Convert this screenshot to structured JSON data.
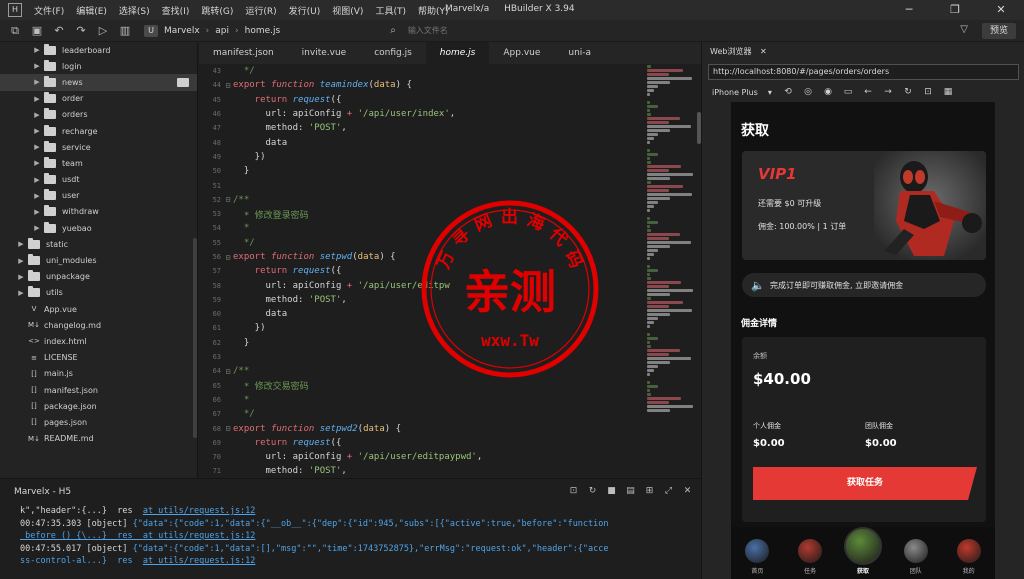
{
  "colors": {
    "keyword": "#e06c75",
    "function": "#61afef",
    "param": "#e5c07b",
    "string": "#98c379",
    "comment": "#6a9955",
    "brand_red": "#e53935",
    "link": "#4fa3e8",
    "watermark_red": "#e00000"
  },
  "menubar": {
    "items": [
      "文件(F)",
      "编辑(E)",
      "选择(S)",
      "查找(I)",
      "跳转(G)",
      "运行(R)",
      "发行(U)",
      "视图(V)",
      "工具(T)",
      "帮助(Y)"
    ],
    "title": "Marvelx/a",
    "app_name": "HBuilder X 3.94"
  },
  "toolbar": {
    "breadcrumb": [
      "Marvelx",
      "api",
      "home.js"
    ],
    "search_placeholder": "输入文件名",
    "preview_label": "预览"
  },
  "sidebar": {
    "items": [
      {
        "label": "leaderboard",
        "type": "folder",
        "depth": 2,
        "expandable": true
      },
      {
        "label": "login",
        "type": "folder",
        "depth": 2,
        "expandable": true
      },
      {
        "label": "news",
        "type": "folder",
        "depth": 2,
        "expandable": true,
        "selected": true
      },
      {
        "label": "order",
        "type": "folder",
        "depth": 2,
        "expandable": true
      },
      {
        "label": "orders",
        "type": "folder",
        "depth": 2,
        "expandable": true
      },
      {
        "label": "recharge",
        "type": "folder",
        "depth": 2,
        "expandable": true
      },
      {
        "label": "service",
        "type": "folder",
        "depth": 2,
        "expandable": true
      },
      {
        "label": "team",
        "type": "folder",
        "depth": 2,
        "expandable": true
      },
      {
        "label": "usdt",
        "type": "folder",
        "depth": 2,
        "expandable": true
      },
      {
        "label": "user",
        "type": "folder",
        "depth": 2,
        "expandable": true
      },
      {
        "label": "withdraw",
        "type": "folder",
        "depth": 2,
        "expandable": true
      },
      {
        "label": "yuebao",
        "type": "folder",
        "depth": 2,
        "expandable": true
      },
      {
        "label": "static",
        "type": "folder",
        "depth": 1,
        "expandable": true
      },
      {
        "label": "uni_modules",
        "type": "folder",
        "depth": 1,
        "expandable": true
      },
      {
        "label": "unpackage",
        "type": "folder",
        "depth": 1,
        "expandable": true
      },
      {
        "label": "utils",
        "type": "folder",
        "depth": 1,
        "expandable": true
      },
      {
        "label": "App.vue",
        "type": "file",
        "icon": "V",
        "depth": 1
      },
      {
        "label": "changelog.md",
        "type": "file",
        "icon": "M↓",
        "depth": 1
      },
      {
        "label": "index.html",
        "type": "file",
        "icon": "<>",
        "depth": 1
      },
      {
        "label": "LICENSE",
        "type": "file",
        "icon": "≡",
        "depth": 1
      },
      {
        "label": "main.js",
        "type": "file",
        "icon": "[]",
        "depth": 1
      },
      {
        "label": "manifest.json",
        "type": "file",
        "icon": "[]",
        "depth": 1
      },
      {
        "label": "package.json",
        "type": "file",
        "icon": "[]",
        "depth": 1
      },
      {
        "label": "pages.json",
        "type": "file",
        "icon": "[]",
        "depth": 1
      },
      {
        "label": "README.md",
        "type": "file",
        "icon": "M↓",
        "depth": 1
      }
    ]
  },
  "editor": {
    "tabs": [
      {
        "label": "manifest.json"
      },
      {
        "label": "invite.vue"
      },
      {
        "label": "config.js"
      },
      {
        "label": "home.js",
        "active": true
      },
      {
        "label": "App.vue"
      },
      {
        "label": "uni-a"
      }
    ],
    "lines": [
      {
        "n": "43",
        "fold": "",
        "tokens": [
          [
            "  */",
            "comment"
          ]
        ]
      },
      {
        "n": "44",
        "fold": "⊟",
        "tokens": [
          [
            "export ",
            "keyword"
          ],
          [
            "function ",
            "keyword"
          ],
          [
            "teamindex",
            "function"
          ],
          [
            "(",
            "plain"
          ],
          [
            "data",
            "param"
          ],
          [
            ") {",
            "plain"
          ]
        ]
      },
      {
        "n": "45",
        "fold": "",
        "tokens": [
          [
            "    return ",
            "keyword"
          ],
          [
            "request",
            "function"
          ],
          [
            "({",
            "plain"
          ]
        ]
      },
      {
        "n": "46",
        "fold": "",
        "tokens": [
          [
            "      url: apiConfig ",
            "plain"
          ],
          [
            "+ ",
            "keyword"
          ],
          [
            "'/api/user/index'",
            "string"
          ],
          [
            ",",
            "plain"
          ]
        ]
      },
      {
        "n": "47",
        "fold": "",
        "tokens": [
          [
            "      method: ",
            "plain"
          ],
          [
            "'POST'",
            "string"
          ],
          [
            ",",
            "plain"
          ]
        ]
      },
      {
        "n": "48",
        "fold": "",
        "tokens": [
          [
            "      data",
            "plain"
          ]
        ]
      },
      {
        "n": "49",
        "fold": "",
        "tokens": [
          [
            "    })",
            "plain"
          ]
        ]
      },
      {
        "n": "50",
        "fold": "",
        "tokens": [
          [
            "  }",
            "plain"
          ]
        ]
      },
      {
        "n": "51",
        "fold": "",
        "tokens": []
      },
      {
        "n": "52",
        "fold": "⊟",
        "tokens": [
          [
            "/**",
            "comment"
          ]
        ]
      },
      {
        "n": "53",
        "fold": "",
        "tokens": [
          [
            "  * 修改登录密码",
            "comment"
          ]
        ]
      },
      {
        "n": "54",
        "fold": "",
        "tokens": [
          [
            "  *",
            "comment"
          ]
        ]
      },
      {
        "n": "55",
        "fold": "",
        "tokens": [
          [
            "  */",
            "comment"
          ]
        ]
      },
      {
        "n": "56",
        "fold": "⊟",
        "tokens": [
          [
            "export ",
            "keyword"
          ],
          [
            "function ",
            "keyword"
          ],
          [
            "setpwd",
            "function"
          ],
          [
            "(",
            "plain"
          ],
          [
            "data",
            "param"
          ],
          [
            ") {",
            "plain"
          ]
        ]
      },
      {
        "n": "57",
        "fold": "",
        "tokens": [
          [
            "    return ",
            "keyword"
          ],
          [
            "request",
            "function"
          ],
          [
            "({",
            "plain"
          ]
        ]
      },
      {
        "n": "58",
        "fold": "",
        "tokens": [
          [
            "      url: apiConfig ",
            "plain"
          ],
          [
            "+ ",
            "keyword"
          ],
          [
            "'/api/user/editpw",
            "string"
          ]
        ]
      },
      {
        "n": "59",
        "fold": "",
        "tokens": [
          [
            "      method: ",
            "plain"
          ],
          [
            "'POST'",
            "string"
          ],
          [
            ",",
            "plain"
          ]
        ]
      },
      {
        "n": "60",
        "fold": "",
        "tokens": [
          [
            "      data",
            "plain"
          ]
        ]
      },
      {
        "n": "61",
        "fold": "",
        "tokens": [
          [
            "    })",
            "plain"
          ]
        ]
      },
      {
        "n": "62",
        "fold": "",
        "tokens": [
          [
            "  }",
            "plain"
          ]
        ]
      },
      {
        "n": "63",
        "fold": "",
        "tokens": []
      },
      {
        "n": "64",
        "fold": "⊟",
        "tokens": [
          [
            "/**",
            "comment"
          ]
        ]
      },
      {
        "n": "65",
        "fold": "",
        "tokens": [
          [
            "  * 修改交易密码",
            "comment"
          ]
        ]
      },
      {
        "n": "66",
        "fold": "",
        "tokens": [
          [
            "  *",
            "comment"
          ]
        ]
      },
      {
        "n": "67",
        "fold": "",
        "tokens": [
          [
            "  */",
            "comment"
          ]
        ]
      },
      {
        "n": "68",
        "fold": "⊟",
        "tokens": [
          [
            "export ",
            "keyword"
          ],
          [
            "function ",
            "keyword"
          ],
          [
            "setpwd2",
            "function"
          ],
          [
            "(",
            "plain"
          ],
          [
            "data",
            "param"
          ],
          [
            ") {",
            "plain"
          ]
        ]
      },
      {
        "n": "69",
        "fold": "",
        "tokens": [
          [
            "    return ",
            "keyword"
          ],
          [
            "request",
            "function"
          ],
          [
            "({",
            "plain"
          ]
        ]
      },
      {
        "n": "70",
        "fold": "",
        "tokens": [
          [
            "      url: apiConfig ",
            "plain"
          ],
          [
            "+ ",
            "keyword"
          ],
          [
            "'/api/user/editpaypwd'",
            "string"
          ],
          [
            ",",
            "plain"
          ]
        ]
      },
      {
        "n": "71",
        "fold": "",
        "tokens": [
          [
            "      method: ",
            "plain"
          ],
          [
            "'POST'",
            "string"
          ],
          [
            ",",
            "plain"
          ]
        ]
      }
    ]
  },
  "browser": {
    "tab_label": "Web浏览器",
    "url": "http://localhost:8080/#/pages/orders/orders",
    "device": "iPhone Plus"
  },
  "phone": {
    "title": "获取",
    "vip": {
      "name": "VIP1",
      "line1": "还需要 $0 可升级",
      "line2": "佣金: 100.00% | 1 订单"
    },
    "notice": "完成订单即可赚取佣金, 立即邀请佣金",
    "section_title": "佣金详情",
    "earnings": {
      "label": "余额",
      "total": "$40.00",
      "personal_label": "个人佣金",
      "personal_value": "$0.00",
      "team_label": "团队佣金",
      "team_value": "$0.00"
    },
    "button_label": "获取任务",
    "tabbar": [
      {
        "label": "首页",
        "color": "#4a6fa5"
      },
      {
        "label": "任务",
        "color": "#b03a2e"
      },
      {
        "label": "获取",
        "color": "#5d8a3a",
        "center": true
      },
      {
        "label": "团队",
        "color": "#8a8a8a"
      },
      {
        "label": "我的",
        "color": "#c0392b"
      }
    ]
  },
  "console": {
    "title": "Marvelx - H5",
    "lines": [
      [
        [
          "k\",\"header\":{...}  res  ",
          "plain"
        ],
        [
          "at utils/request.js:12",
          "link"
        ]
      ],
      [
        [
          "00:47:35.303 [object] ",
          "plain"
        ],
        [
          "{\"data\":{\"code\":1,\"data\":{\"__ob__\":{\"dep\":{\"id\":945,\"subs\":[{\"active\":true,\"before\":\"function",
          "json"
        ]
      ],
      [
        [
          " before () {\\...}  res  ",
          "link"
        ],
        [
          "at utils/request.js:12",
          "link"
        ]
      ],
      [
        [
          "00:47:55.017 [object] ",
          "plain"
        ],
        [
          "{\"data\":{\"code\":1,\"data\":[],\"msg\":\"\",\"time\":1743752875},\"errMsg\":\"request:ok\",\"header\":{\"acce",
          "json"
        ]
      ],
      [
        [
          "ss-control-al...}  res  ",
          "json"
        ],
        [
          "at utils/request.js:12",
          "link"
        ]
      ]
    ]
  },
  "watermark": {
    "top_text": "万 寻 网 出 海 代 码",
    "center_text": "亲测",
    "bottom_text": "wxw.Tw"
  }
}
